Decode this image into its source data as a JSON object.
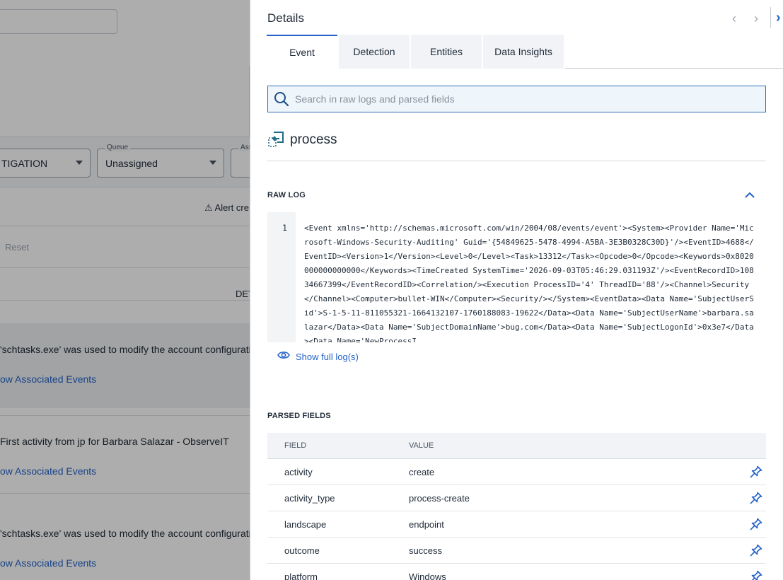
{
  "background": {
    "investigation_select": "TIGATION",
    "queue_label": "Queue",
    "queue_value": "Unassigned",
    "assignee_label_fragment": "Ass",
    "alert_text": "⚠ Alert cre",
    "reset_label": "Reset",
    "column_fragment": "DET",
    "cards": [
      {
        "text": "'schtasks.exe' was used to modify the account configurati",
        "link": "ow Associated Events"
      },
      {
        "text": "First activity from jp for Barbara Salazar - ObserveIT",
        "link": "ow Associated Events"
      },
      {
        "text": "'schtasks.exe' was used to modify the account configurati",
        "link": "ow Associated Events"
      }
    ]
  },
  "panel": {
    "title": "Details",
    "nav": {
      "prev": "‹",
      "next": "›",
      "close": "›"
    },
    "tabs": [
      "Event",
      "Detection",
      "Entities",
      "Data Insights"
    ],
    "active_tab": "Event",
    "search_placeholder": "Search in raw logs and parsed fields",
    "event_type": "process",
    "raw_log": {
      "title": "RAW LOG",
      "line_number": "1",
      "text": "<Event xmlns='http://schemas.microsoft.com/win/2004/08/events/event'><System><Provider Name='Microsoft-Windows-Security-Auditing' Guid='{54849625-5478-4994-A5BA-3E3B0328C30D}'/><EventID>4688</EventID><Version>1</Version><Level>0</Level><Task>13312</Task><Opcode>0</Opcode><Keywords>0x8020000000000000</Keywords><TimeCreated SystemTime='2026-09-03T05:46:29.031193Z'/><EventRecordID>10834667399</EventRecordID><Correlation/><Execution ProcessID='4' ThreadID='88'/><Channel>Security</Channel><Computer>bullet-WIN</Computer><Security/></System><EventData><Data Name='SubjectUserSid'>S-1-5-11-811055321-1664132107-1760188083-19622</Data><Data Name='SubjectUserName'>barbara.salazar</Data><Data Name='SubjectDomainName'>bug.com</Data><Data Name='SubjectLogonId'>0x3e7</Data><Data Name='NewProcessI",
      "show_full_label": "Show full log(s)"
    },
    "parsed_fields": {
      "title": "PARSED FIELDS",
      "col_field": "FIELD",
      "col_value": "VALUE",
      "rows": [
        {
          "field": "activity",
          "value": "create"
        },
        {
          "field": "activity_type",
          "value": "process-create"
        },
        {
          "field": "landscape",
          "value": "endpoint"
        },
        {
          "field": "outcome",
          "value": "success"
        },
        {
          "field": "platform",
          "value": "Windows"
        }
      ]
    }
  },
  "colors": {
    "accent": "#2563c9",
    "overlay": "rgba(0,0,0,0.32)"
  },
  "icons": {
    "search": "search-icon",
    "process": "process-icon",
    "collapse": "chevron-up-icon",
    "eye": "eye-icon",
    "pin": "pin-icon"
  }
}
